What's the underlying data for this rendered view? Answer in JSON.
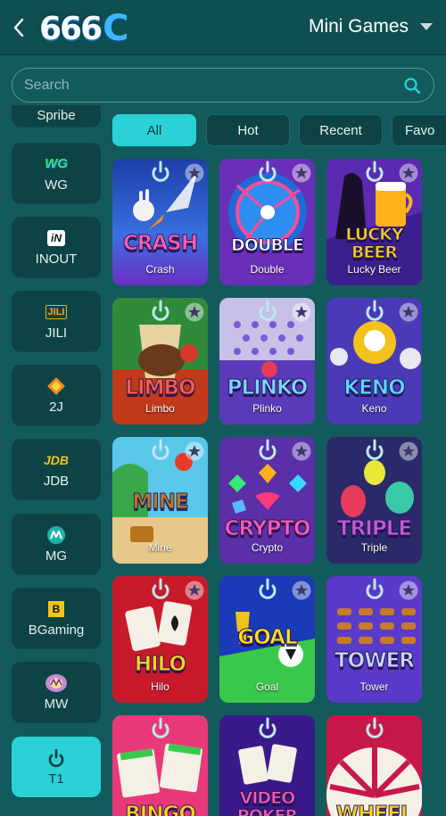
{
  "header": {
    "title": "Mini Games",
    "logo_text": "666",
    "logo_letter": "C"
  },
  "search": {
    "placeholder": "Search"
  },
  "providers": [
    {
      "label": "Spribe"
    },
    {
      "label": "WG",
      "badge": "WG"
    },
    {
      "label": "INOUT",
      "badge": "iN"
    },
    {
      "label": "JILI",
      "badge": "JILI"
    },
    {
      "label": "2J"
    },
    {
      "label": "JDB",
      "badge": "JDB"
    },
    {
      "label": "MG"
    },
    {
      "label": "BGaming",
      "badge": "B"
    },
    {
      "label": "MW"
    },
    {
      "label": "T1"
    }
  ],
  "tabs": [
    {
      "label": "All"
    },
    {
      "label": "Hot"
    },
    {
      "label": "Recent"
    },
    {
      "label": "Favo"
    }
  ],
  "games": [
    {
      "name": "Crash",
      "title": "CRASH"
    },
    {
      "name": "Double",
      "title": "DOUBLE"
    },
    {
      "name": "Lucky Beer",
      "title": "LUCKY BEER"
    },
    {
      "name": "Limbo",
      "title": "LIMBO"
    },
    {
      "name": "Plinko",
      "title": "PLINKO"
    },
    {
      "name": "Keno",
      "title": "KENO"
    },
    {
      "name": "Mine",
      "title": "MINE"
    },
    {
      "name": "Crypto",
      "title": "CRYPTO"
    },
    {
      "name": "Triple",
      "title": "TRIPLE"
    },
    {
      "name": "Hilo",
      "title": "HILO"
    },
    {
      "name": "Goal",
      "title": "GOAL"
    },
    {
      "name": "Tower",
      "title": "TOWER"
    },
    {
      "title": "BINGO"
    },
    {
      "title": "VIDEO POKER"
    },
    {
      "title": "WHEEL"
    }
  ],
  "colors": {
    "background": "#135a5c",
    "accent": "#2ad2d8",
    "tile": "#0e4345"
  }
}
